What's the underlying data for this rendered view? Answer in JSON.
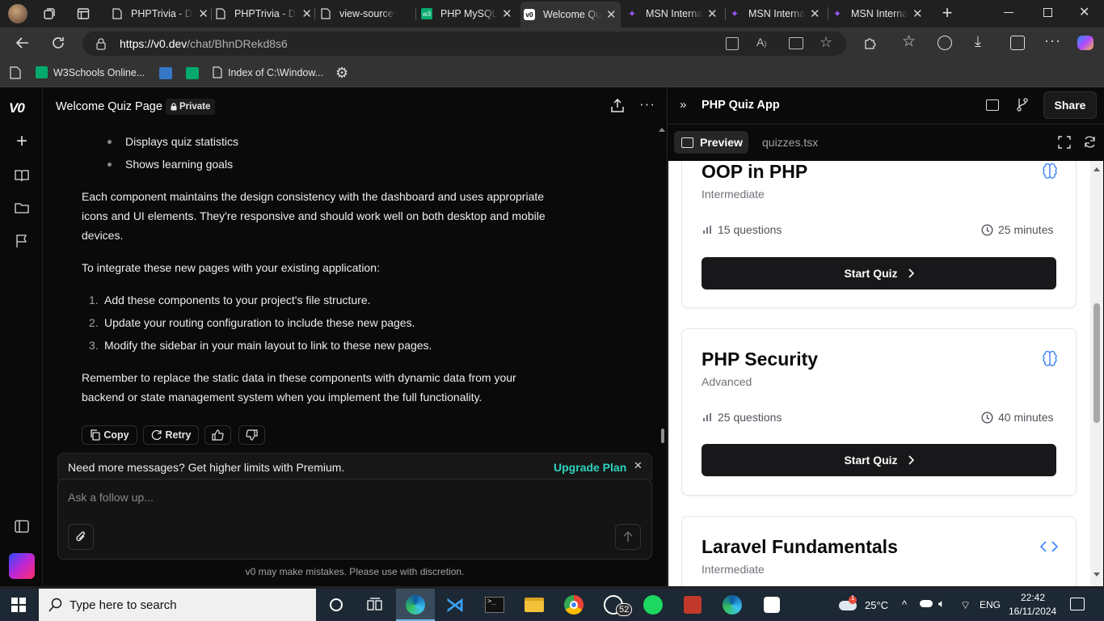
{
  "browser": {
    "tabs": [
      {
        "label": "PHPTrivia - D",
        "icon": "page-icon"
      },
      {
        "label": "PHPTrivia - D",
        "icon": "page-icon"
      },
      {
        "label": "view-source:",
        "icon": "page-icon"
      },
      {
        "label": "PHP MySQL",
        "icon": "w3schools-icon"
      },
      {
        "label": "Welcome Qu",
        "icon": "v0-icon",
        "active": true
      },
      {
        "label": "MSN Interna",
        "icon": "msn-icon"
      },
      {
        "label": "MSN Interna",
        "icon": "msn-icon"
      },
      {
        "label": "MSN Interna",
        "icon": "msn-icon"
      }
    ],
    "url_host": "https://v0.dev",
    "url_path": "/chat/BhnDRekd8s6",
    "bookmarks": [
      {
        "label": "W3Schools Online..."
      },
      {
        "label": "Index of C:\\Window..."
      }
    ]
  },
  "chat": {
    "title": "Welcome Quiz Page",
    "privacy": "Private",
    "bullets": [
      "Displays quiz statistics",
      "Shows learning goals"
    ],
    "para1_lines": [
      "Each component maintains the design consistency with the dashboard and uses appropriate",
      "icons and UI elements. They're responsive and should work well on both desktop and mobile",
      "devices."
    ],
    "para2": "To integrate these new pages with your existing application:",
    "steps": [
      {
        "num": "1.",
        "text": "Add these components to your project's file structure."
      },
      {
        "num": "2.",
        "text": "Update your routing configuration to include these new pages."
      },
      {
        "num": "3.",
        "text": "Modify the sidebar in your main layout to link to these new pages."
      }
    ],
    "para3_lines": [
      "Remember to replace the static data in these components with dynamic data from your",
      "backend or state management system when you implement the full functionality."
    ],
    "actions": {
      "copy": "Copy",
      "retry": "Retry"
    },
    "upgrade_text": "Need more messages? Get higher limits with Premium.",
    "upgrade_link": "Upgrade Plan",
    "input_placeholder": "Ask a follow up...",
    "disclaimer": "v0 may make mistakes. Please use with discretion."
  },
  "preview": {
    "title": "PHP Quiz App",
    "share": "Share",
    "tab_preview": "Preview",
    "tab_file": "quizzes.tsx",
    "cards": [
      {
        "title": "OOP in PHP",
        "level": "Intermediate",
        "questions": "15 questions",
        "time": "25 minutes",
        "button": "Start Quiz",
        "icon": "brain-icon"
      },
      {
        "title": "PHP Security",
        "level": "Advanced",
        "questions": "25 questions",
        "time": "40 minutes",
        "button": "Start Quiz",
        "icon": "brain-icon"
      },
      {
        "title": "Laravel Fundamentals",
        "level": "Intermediate",
        "icon": "code-icon"
      }
    ]
  },
  "taskbar": {
    "search_placeholder": "Type here to search",
    "whatsapp_badge": "52",
    "weather_badge": "1",
    "temperature": "25°C",
    "language": "ENG",
    "time": "22:42",
    "date": "16/11/2024"
  },
  "colors": {
    "accent_green": "#2dd4bf",
    "accent_blue": "#3b82f6",
    "dark_button": "#18181b"
  }
}
